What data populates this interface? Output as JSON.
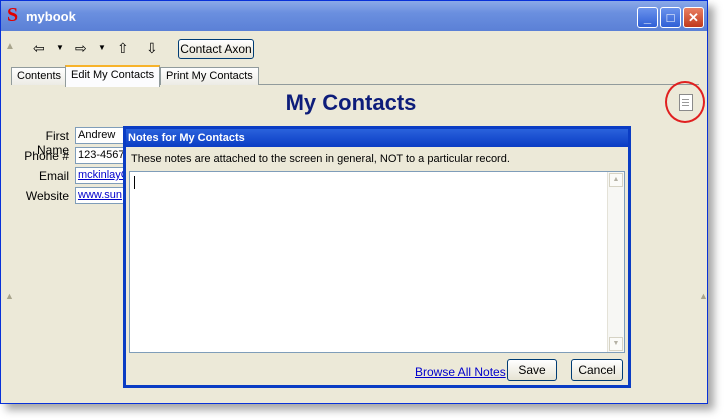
{
  "window": {
    "title": "mybook",
    "logo_glyph": "S",
    "minimize_glyph": "_",
    "maximize_glyph": "□",
    "close_glyph": "✕"
  },
  "toolbar": {
    "back_glyph": "⇦",
    "forward_glyph": "⇨",
    "up_glyph": "⇧",
    "down_glyph": "⇩",
    "caret_glyph": "▼",
    "scroll_glyph": "▲",
    "contact_axon_label": "Contact Axon"
  },
  "tabs": [
    {
      "label": "Contents",
      "active": false
    },
    {
      "label": "Edit My Contacts",
      "active": true
    },
    {
      "label": "Print My Contacts",
      "active": false
    }
  ],
  "page": {
    "title": "My Contacts"
  },
  "fields": [
    {
      "label": "First Name",
      "value": "Andrew"
    },
    {
      "label": "Phone #",
      "value": "123-4567"
    },
    {
      "label": "Email",
      "value": "mckinlayC"
    },
    {
      "label": "Website",
      "value": "www.sun"
    }
  ],
  "notes_dialog": {
    "title": "Notes for My Contacts",
    "description": "These notes are attached to the screen in general, NOT to a particular record.",
    "text": "",
    "browse_link": "Browse All Notes",
    "save_label": "Save",
    "cancel_label": "Cancel",
    "scroll_up_glyph": "▲",
    "scroll_down_glyph": "▼"
  },
  "colors": {
    "title_text": "#0d1d7a",
    "highlight_ring": "#e02020",
    "dialog_border": "#0a3cc4"
  }
}
